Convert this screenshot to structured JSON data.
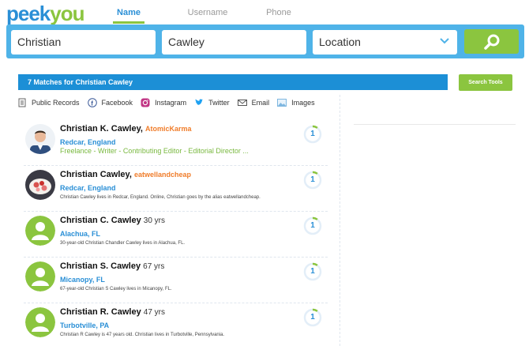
{
  "logo": {
    "part1": "peek",
    "part2": "you"
  },
  "tabs": [
    "Name",
    "Username",
    "Phone"
  ],
  "search": {
    "first": "Christian",
    "last": "Cawley",
    "location_placeholder": "Location"
  },
  "matches_text": "7 Matches for Christian Cawley",
  "search_tools_label": "Search Tools",
  "filters": [
    "Public Records",
    "Facebook",
    "Instagram",
    "Twitter",
    "Email",
    "Images"
  ],
  "results": [
    {
      "name": "Christian K. Cawley",
      "alias": "AtomicKarma",
      "age": "",
      "location": "Redcar, England",
      "description": "Freelance - Writer - Contributing Editor - Editorial Director ...",
      "score": "1",
      "score_fraction": 0.1
    },
    {
      "name": "Christian Cawley",
      "alias": "eatwellandcheap",
      "age": "",
      "location": "Redcar, England",
      "description": "Christian Cawley lives in Redcar, England. Online, Christian goes by the alias eatwellandcheap.",
      "score": "1",
      "score_fraction": 0.1
    },
    {
      "name": "Christian C. Cawley",
      "alias": "",
      "age": "30 yrs",
      "location": "Alachua, FL",
      "description": "30-year-old Christian Chandler Cawley lives in Alachua, FL.",
      "score": "1",
      "score_fraction": 0.1
    },
    {
      "name": "Christian S. Cawley",
      "alias": "",
      "age": "67 yrs",
      "location": "Micanopy, FL",
      "description": "67-year-old Christian S Cawley lives in Micanopy, FL.",
      "score": "1",
      "score_fraction": 0.1
    },
    {
      "name": "Christian R. Cawley",
      "alias": "",
      "age": "47 yrs",
      "location": "Turbotville, PA",
      "description": "Christian R Cawley is 47 years old. Christian lives in Turbotville, Pennsylvania.",
      "score": "1",
      "score_fraction": 0.1
    }
  ],
  "colors": {
    "brand_blue": "#2a8fd6",
    "brand_green": "#8bc53f",
    "alias_orange": "#f07d2b",
    "search_bar": "#4fb3e8"
  }
}
